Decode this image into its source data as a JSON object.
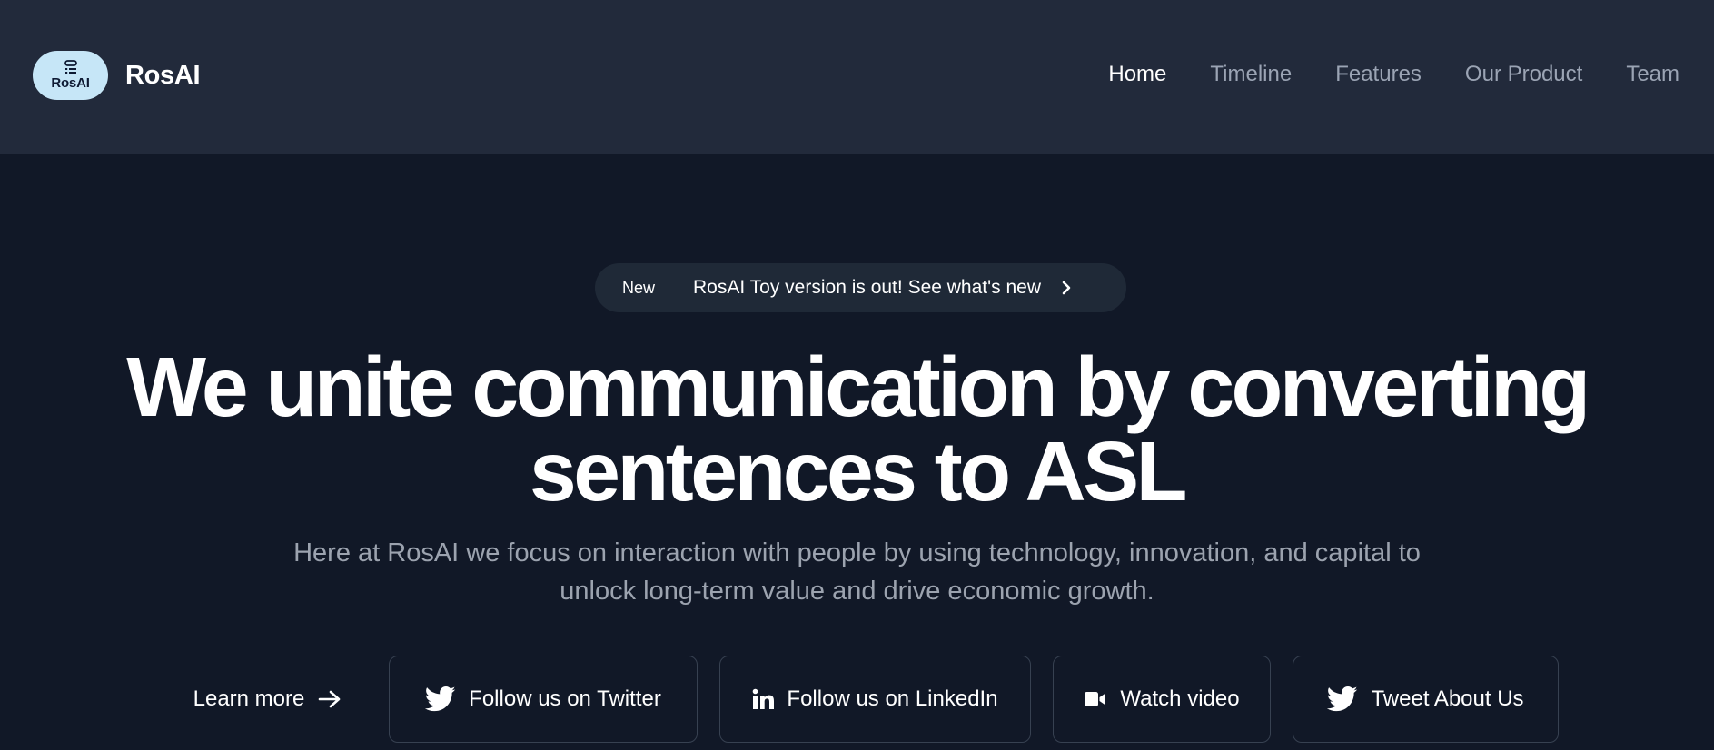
{
  "brand": {
    "logo_text": "RosAI",
    "name": "RosAI"
  },
  "nav": {
    "items": [
      {
        "label": "Home",
        "active": true
      },
      {
        "label": "Timeline"
      },
      {
        "label": "Features"
      },
      {
        "label": "Our Product"
      },
      {
        "label": "Team"
      }
    ]
  },
  "announcement": {
    "badge": "New",
    "text": "RosAI Toy version is out! See what's new",
    "icon": "chevron-right-icon"
  },
  "hero": {
    "title_line1": "We unite communication by converting",
    "title_line2": "sentences to ASL",
    "subtitle": "Here at RosAI we focus on interaction with people by using technology, innovation, and capital to unlock long-term value and drive economic growth."
  },
  "actions": {
    "learn_more": {
      "label": "Learn more",
      "icon": "arrow-right-icon"
    },
    "twitter": {
      "label": "Follow us on Twitter",
      "icon": "twitter-icon"
    },
    "linkedin": {
      "label": "Follow us on LinkedIn",
      "icon": "linkedin-icon"
    },
    "video": {
      "label": "Watch video",
      "icon": "video-camera-icon"
    },
    "tweet": {
      "label": "Tweet About Us",
      "icon": "twitter-icon"
    }
  },
  "colors": {
    "header_bg": "#222a3b",
    "page_bg": "#111827",
    "logo_bg": "#c6e6f7",
    "muted_text": "#9ca3af",
    "pill_bg": "#1f2937",
    "button_border": "#374151"
  }
}
